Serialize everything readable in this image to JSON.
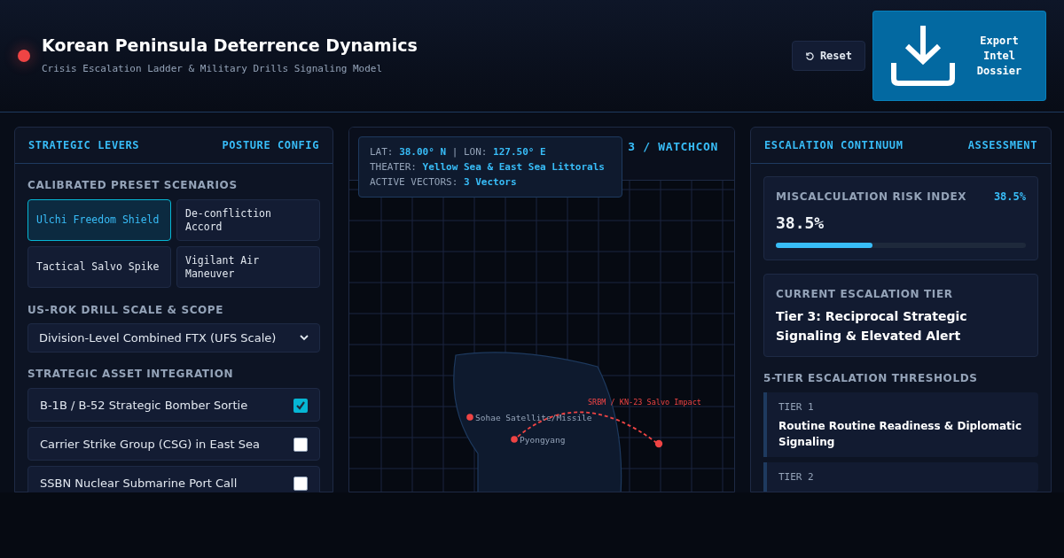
{
  "header": {
    "title": "Korean Peninsula Deterrence Dynamics",
    "subtitle": "Crisis Escalation Ladder & Military Drills Signaling Model",
    "reset_button": "Reset",
    "export_button": "Export Intel Dossier"
  },
  "levers": {
    "title": "STRATEGIC LEVERS",
    "tag": "POSTURE CONFIG",
    "presets_label": "CALIBRATED PRESET SCENARIOS",
    "presets": [
      {
        "label": "Ulchi Freedom Shield",
        "selected": true
      },
      {
        "label": "De-confliction Accord",
        "selected": false
      },
      {
        "label": "Tactical Salvo Spike",
        "selected": false
      },
      {
        "label": "Vigilant Air Maneuver",
        "selected": false
      }
    ],
    "scale_label": "US-ROK DRILL SCALE & SCOPE",
    "scale_value": "Division-Level Combined FTX (UFS Scale)",
    "assets_label": "STRATEGIC ASSET INTEGRATION",
    "assets": [
      {
        "label": "B-1B / B-52 Strategic Bomber Sortie",
        "checked": true
      },
      {
        "label": "Carrier Strike Group (CSG) in East Sea",
        "checked": false
      },
      {
        "label": "SSBN Nuclear Submarine Port Call",
        "checked": false
      }
    ]
  },
  "map": {
    "header": "3 / WATCHCON",
    "info": [
      {
        "label": "LAT:",
        "value": "38.00° N"
      },
      {
        "label": "| LON:",
        "value": "127.50° E"
      },
      {
        "label": "THEATER:",
        "value": "Yellow Sea & East Sea Littorals"
      },
      {
        "label": "ACTIVE VECTORS:",
        "value": "3 Vectors"
      }
    ],
    "markers": [
      {
        "label": "Sohae Satellite/Missile",
        "color": "#ef4444"
      },
      {
        "label": "Pyongyang",
        "color": "#ef4444"
      }
    ],
    "vector": {
      "label": "SRBM / KN-23 Salvo Impact",
      "color": "#ef4444"
    }
  },
  "assessment": {
    "title": "ESCALATION CONTINUUM",
    "tag": "ASSESSMENT",
    "risk": {
      "label": "MISCALCULATION RISK INDEX",
      "badge": "38.5%",
      "value": "38.5%",
      "level": 0.385
    },
    "tier_label": "CURRENT ESCALATION TIER",
    "tier_value": "Tier 3: Reciprocal Strategic Signaling & Elevated Alert",
    "thresholds_label": "5-TIER ESCALATION THRESHOLDS",
    "thresholds": [
      {
        "tier": "TIER 1",
        "text": "Routine Routine Readiness & Diplomatic Signaling"
      },
      {
        "tier": "TIER 2"
      }
    ]
  }
}
